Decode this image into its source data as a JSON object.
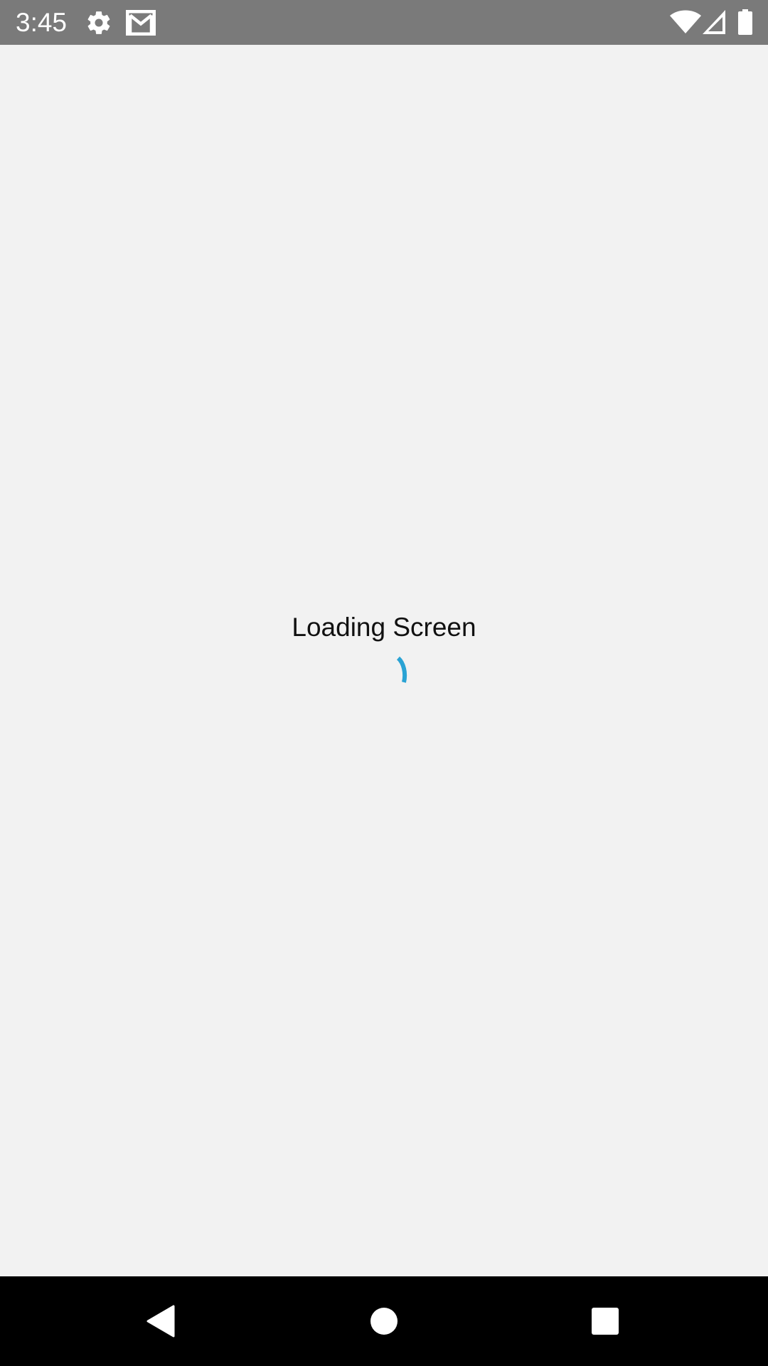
{
  "status_bar": {
    "time": "3:45",
    "icons": [
      "gear-icon",
      "gmail-icon",
      "wifi-icon",
      "signal-icon",
      "battery-icon"
    ],
    "background": "#7a7a7a"
  },
  "main": {
    "loading_label": "Loading Screen",
    "spinner_color": "#2aa3d4",
    "background": "#f2f2f2"
  },
  "nav_bar": {
    "buttons": [
      "back-icon",
      "home-icon",
      "recents-icon"
    ],
    "background": "#000000"
  }
}
